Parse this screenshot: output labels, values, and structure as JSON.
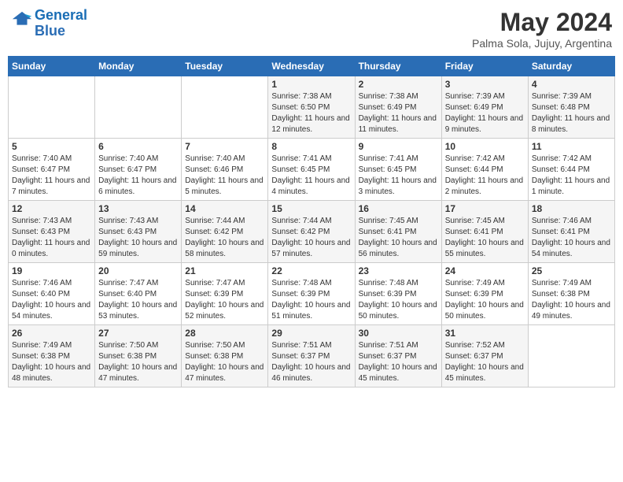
{
  "header": {
    "logo_line1": "General",
    "logo_line2": "Blue",
    "main_title": "May 2024",
    "subtitle": "Palma Sola, Jujuy, Argentina"
  },
  "days_of_week": [
    "Sunday",
    "Monday",
    "Tuesday",
    "Wednesday",
    "Thursday",
    "Friday",
    "Saturday"
  ],
  "weeks": [
    [
      {
        "day": "",
        "info": ""
      },
      {
        "day": "",
        "info": ""
      },
      {
        "day": "",
        "info": ""
      },
      {
        "day": "1",
        "info": "Sunrise: 7:38 AM\nSunset: 6:50 PM\nDaylight: 11 hours and 12 minutes."
      },
      {
        "day": "2",
        "info": "Sunrise: 7:38 AM\nSunset: 6:49 PM\nDaylight: 11 hours and 11 minutes."
      },
      {
        "day": "3",
        "info": "Sunrise: 7:39 AM\nSunset: 6:49 PM\nDaylight: 11 hours and 9 minutes."
      },
      {
        "day": "4",
        "info": "Sunrise: 7:39 AM\nSunset: 6:48 PM\nDaylight: 11 hours and 8 minutes."
      }
    ],
    [
      {
        "day": "5",
        "info": "Sunrise: 7:40 AM\nSunset: 6:47 PM\nDaylight: 11 hours and 7 minutes."
      },
      {
        "day": "6",
        "info": "Sunrise: 7:40 AM\nSunset: 6:47 PM\nDaylight: 11 hours and 6 minutes."
      },
      {
        "day": "7",
        "info": "Sunrise: 7:40 AM\nSunset: 6:46 PM\nDaylight: 11 hours and 5 minutes."
      },
      {
        "day": "8",
        "info": "Sunrise: 7:41 AM\nSunset: 6:45 PM\nDaylight: 11 hours and 4 minutes."
      },
      {
        "day": "9",
        "info": "Sunrise: 7:41 AM\nSunset: 6:45 PM\nDaylight: 11 hours and 3 minutes."
      },
      {
        "day": "10",
        "info": "Sunrise: 7:42 AM\nSunset: 6:44 PM\nDaylight: 11 hours and 2 minutes."
      },
      {
        "day": "11",
        "info": "Sunrise: 7:42 AM\nSunset: 6:44 PM\nDaylight: 11 hours and 1 minute."
      }
    ],
    [
      {
        "day": "12",
        "info": "Sunrise: 7:43 AM\nSunset: 6:43 PM\nDaylight: 11 hours and 0 minutes."
      },
      {
        "day": "13",
        "info": "Sunrise: 7:43 AM\nSunset: 6:43 PM\nDaylight: 10 hours and 59 minutes."
      },
      {
        "day": "14",
        "info": "Sunrise: 7:44 AM\nSunset: 6:42 PM\nDaylight: 10 hours and 58 minutes."
      },
      {
        "day": "15",
        "info": "Sunrise: 7:44 AM\nSunset: 6:42 PM\nDaylight: 10 hours and 57 minutes."
      },
      {
        "day": "16",
        "info": "Sunrise: 7:45 AM\nSunset: 6:41 PM\nDaylight: 10 hours and 56 minutes."
      },
      {
        "day": "17",
        "info": "Sunrise: 7:45 AM\nSunset: 6:41 PM\nDaylight: 10 hours and 55 minutes."
      },
      {
        "day": "18",
        "info": "Sunrise: 7:46 AM\nSunset: 6:41 PM\nDaylight: 10 hours and 54 minutes."
      }
    ],
    [
      {
        "day": "19",
        "info": "Sunrise: 7:46 AM\nSunset: 6:40 PM\nDaylight: 10 hours and 54 minutes."
      },
      {
        "day": "20",
        "info": "Sunrise: 7:47 AM\nSunset: 6:40 PM\nDaylight: 10 hours and 53 minutes."
      },
      {
        "day": "21",
        "info": "Sunrise: 7:47 AM\nSunset: 6:39 PM\nDaylight: 10 hours and 52 minutes."
      },
      {
        "day": "22",
        "info": "Sunrise: 7:48 AM\nSunset: 6:39 PM\nDaylight: 10 hours and 51 minutes."
      },
      {
        "day": "23",
        "info": "Sunrise: 7:48 AM\nSunset: 6:39 PM\nDaylight: 10 hours and 50 minutes."
      },
      {
        "day": "24",
        "info": "Sunrise: 7:49 AM\nSunset: 6:39 PM\nDaylight: 10 hours and 50 minutes."
      },
      {
        "day": "25",
        "info": "Sunrise: 7:49 AM\nSunset: 6:38 PM\nDaylight: 10 hours and 49 minutes."
      }
    ],
    [
      {
        "day": "26",
        "info": "Sunrise: 7:49 AM\nSunset: 6:38 PM\nDaylight: 10 hours and 48 minutes."
      },
      {
        "day": "27",
        "info": "Sunrise: 7:50 AM\nSunset: 6:38 PM\nDaylight: 10 hours and 47 minutes."
      },
      {
        "day": "28",
        "info": "Sunrise: 7:50 AM\nSunset: 6:38 PM\nDaylight: 10 hours and 47 minutes."
      },
      {
        "day": "29",
        "info": "Sunrise: 7:51 AM\nSunset: 6:37 PM\nDaylight: 10 hours and 46 minutes."
      },
      {
        "day": "30",
        "info": "Sunrise: 7:51 AM\nSunset: 6:37 PM\nDaylight: 10 hours and 45 minutes."
      },
      {
        "day": "31",
        "info": "Sunrise: 7:52 AM\nSunset: 6:37 PM\nDaylight: 10 hours and 45 minutes."
      },
      {
        "day": "",
        "info": ""
      }
    ]
  ]
}
